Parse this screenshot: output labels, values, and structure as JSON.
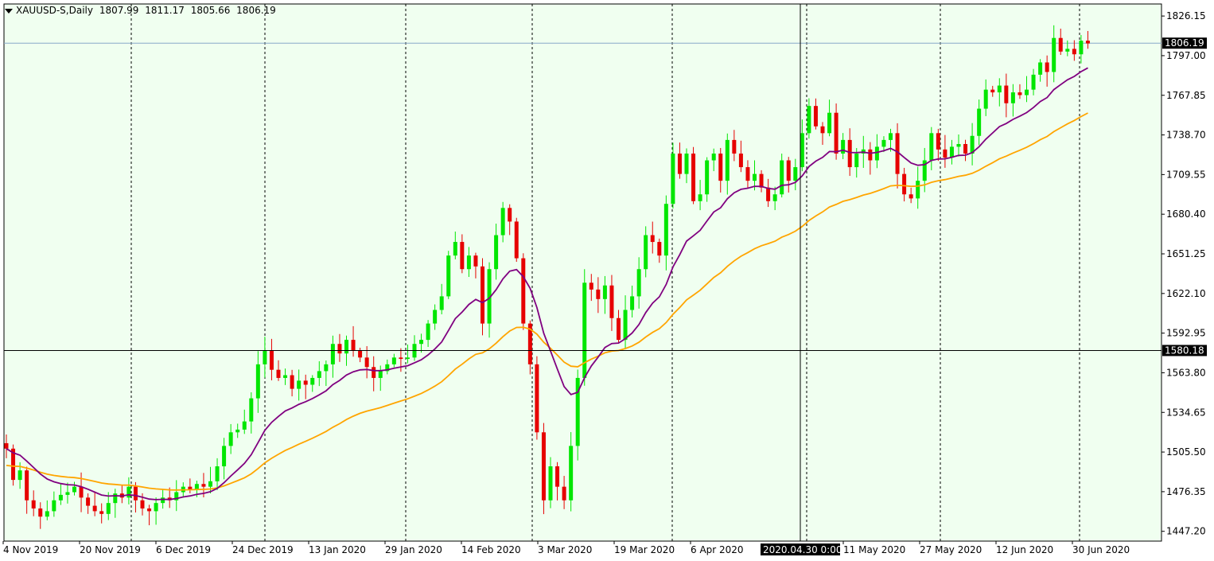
{
  "header": {
    "symbol": "XAUUSD-S,Daily",
    "open": "1807.99",
    "high": "1811.17",
    "low": "1805.66",
    "close": "1806.19"
  },
  "colors": {
    "background": "#f0fff0",
    "bull_candle": "#00e600",
    "bear_candle": "#e60000",
    "ma_fast": "#800080",
    "ma_slow": "#ffa500",
    "grid": "#000000",
    "price_line": "#87a8c8"
  },
  "crosshair": {
    "price_label": "1580.18",
    "time_label": "2020.04.30 0:00"
  },
  "current_price_label": "1806.19",
  "chart_data": {
    "type": "candlestick",
    "title": "XAUUSD-S,Daily",
    "y_ticks": [
      "1826.15",
      "1797.00",
      "1767.85",
      "1738.70",
      "1709.55",
      "1680.40",
      "1651.25",
      "1622.10",
      "1592.95",
      "1563.80",
      "1534.65",
      "1505.50",
      "1476.35",
      "1447.20"
    ],
    "x_labels": [
      "4 Nov 2019",
      "20 Nov 2019",
      "6 Dec 2019",
      "24 Dec 2019",
      "13 Jan 2020",
      "29 Jan 2020",
      "14 Feb 2020",
      "3 Mar 2020",
      "19 Mar 2020",
      "6 Apr 2020",
      "11 May 2020",
      "27 May 2020",
      "12 Jun 2020",
      "30 Jun 2020"
    ],
    "ylim": [
      1440,
      1835
    ],
    "grid": "vertical-dotted",
    "closes": [
      1508,
      1485,
      1492,
      1470,
      1464,
      1458,
      1462,
      1470,
      1474,
      1476,
      1480,
      1472,
      1466,
      1462,
      1460,
      1468,
      1475,
      1472,
      1480,
      1470,
      1464,
      1462,
      1468,
      1472,
      1470,
      1476,
      1480,
      1478,
      1482,
      1480,
      1484,
      1495,
      1510,
      1520,
      1522,
      1528,
      1545,
      1570,
      1580,
      1566,
      1560,
      1562,
      1552,
      1558,
      1555,
      1560,
      1565,
      1570,
      1585,
      1578,
      1588,
      1580,
      1575,
      1568,
      1560,
      1565,
      1570,
      1575,
      1574,
      1575,
      1585,
      1588,
      1600,
      1610,
      1620,
      1650,
      1660,
      1640,
      1650,
      1642,
      1600,
      1640,
      1665,
      1685,
      1675,
      1648,
      1600,
      1570,
      1520,
      1470,
      1495,
      1480,
      1470,
      1510,
      1560,
      1630,
      1625,
      1618,
      1628,
      1604,
      1588,
      1610,
      1620,
      1640,
      1665,
      1660,
      1650,
      1688,
      1725,
      1710,
      1725,
      1690,
      1695,
      1720,
      1725,
      1705,
      1735,
      1725,
      1715,
      1705,
      1710,
      1700,
      1690,
      1695,
      1720,
      1705,
      1715,
      1740,
      1760,
      1745,
      1740,
      1755,
      1725,
      1735,
      1715,
      1725,
      1728,
      1720,
      1730,
      1735,
      1740,
      1710,
      1695,
      1692,
      1705,
      1720,
      1740,
      1728,
      1722,
      1730,
      1732,
      1725,
      1738,
      1758,
      1772,
      1770,
      1775,
      1762,
      1770,
      1768,
      1772,
      1783,
      1792,
      1785,
      1810,
      1800,
      1802,
      1798,
      1808,
      1806
    ]
  }
}
